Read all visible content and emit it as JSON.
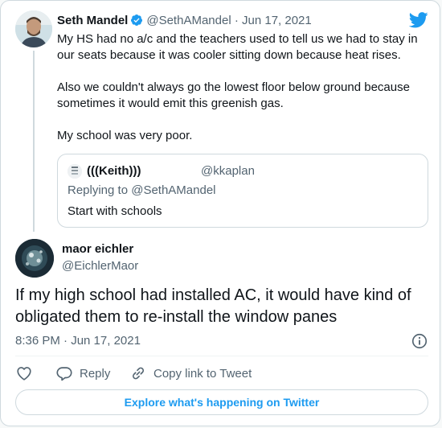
{
  "colors": {
    "brand": "#1d9bf0",
    "text": "#0f1419",
    "muted": "#536471",
    "border": "#cfd9de"
  },
  "tweet_parent": {
    "author_name": "Seth Mandel",
    "author_handle": "@SethAMandel",
    "separator": "·",
    "date": "Jun 17, 2021",
    "paragraphs": [
      "My HS had no a/c and the teachers used to tell us we had to stay in our seats because it was cooler sitting down because heat rises.",
      "Also we couldn't always go the lowest floor below ground because sometimes it would emit this greenish gas.",
      "My school was very poor."
    ],
    "quoted": {
      "author_name": "(((Keith)))",
      "author_handle": "@kkaplan",
      "replying_to": "Replying to @SethAMandel",
      "text": "Start with schools"
    }
  },
  "tweet_main": {
    "author_name": "maor eichler",
    "author_handle": "@EichlerMaor",
    "text": "If my high school had installed AC, it would have kind of obligated them to re-install the window panes",
    "timestamp": "8:36 PM · Jun 17, 2021"
  },
  "actions": {
    "reply_label": "Reply",
    "copy_label": "Copy link to Tweet"
  },
  "explore_label": "Explore what's happening on Twitter",
  "icons": [
    "twitter-bird-icon",
    "verified-badge-icon",
    "heart-icon",
    "reply-icon",
    "link-icon",
    "info-icon"
  ]
}
